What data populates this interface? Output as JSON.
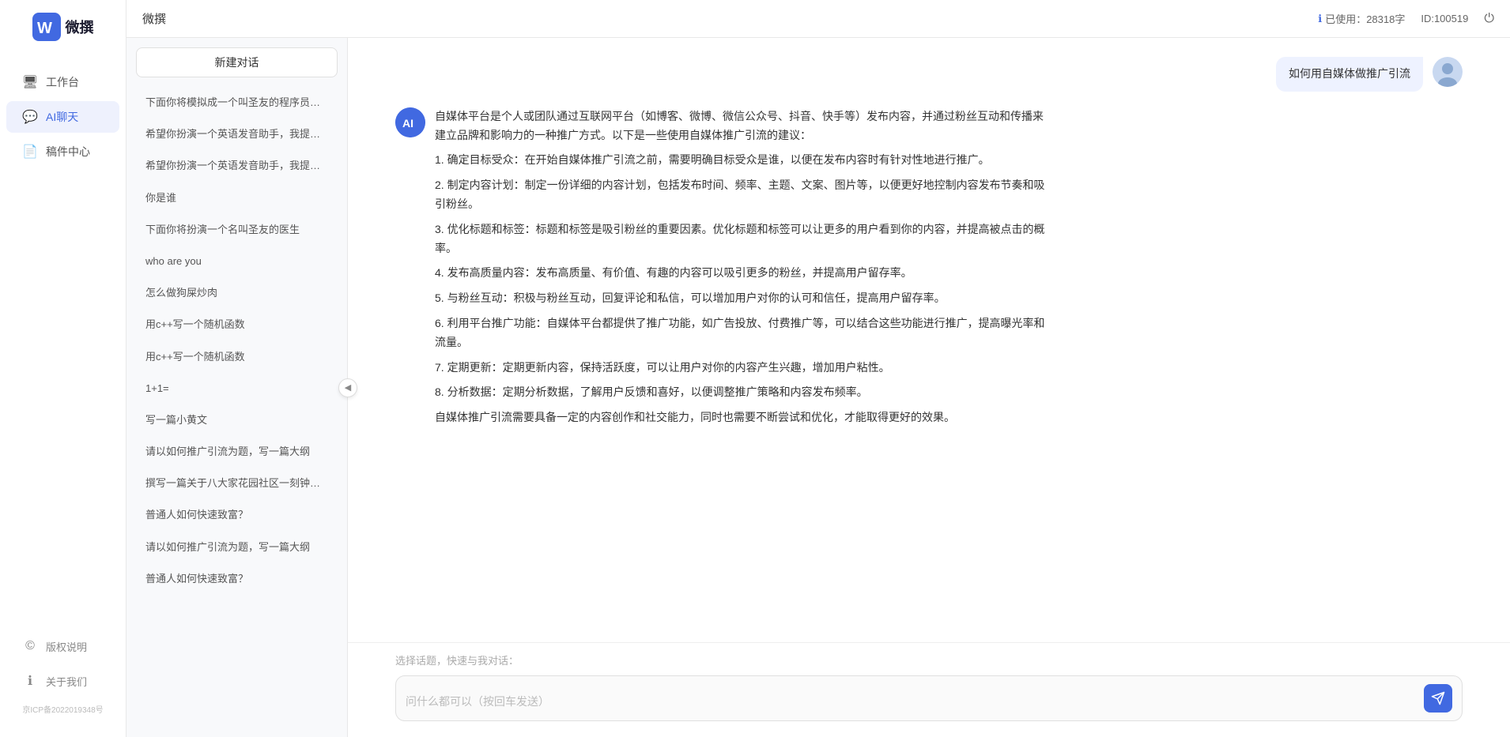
{
  "app": {
    "name": "微撰",
    "logo_letter": "W"
  },
  "topbar": {
    "title": "微撰",
    "usage_label": "已使用：28318字",
    "id_label": "ID:100519",
    "usage_icon": "ℹ"
  },
  "nav": {
    "items": [
      {
        "id": "workspace",
        "label": "工作台",
        "icon": "🖥"
      },
      {
        "id": "ai-chat",
        "label": "AI聊天",
        "icon": "💬",
        "active": true
      },
      {
        "id": "drafts",
        "label": "稿件中心",
        "icon": "📄"
      }
    ],
    "bottom_items": [
      {
        "id": "copyright",
        "label": "版权说明",
        "icon": "©"
      },
      {
        "id": "about",
        "label": "关于我们",
        "icon": "ℹ"
      }
    ],
    "icp": "京ICP备2022019348号"
  },
  "chat_list": {
    "new_chat_label": "新建对话",
    "items": [
      {
        "id": 1,
        "text": "下面你将模拟成一个叫圣友的程序员，我说..."
      },
      {
        "id": 2,
        "text": "希望你扮演一个英语发音助手，我提供给你..."
      },
      {
        "id": 3,
        "text": "希望你扮演一个英语发音助手，我提供给你..."
      },
      {
        "id": 4,
        "text": "你是谁",
        "active": true
      },
      {
        "id": 5,
        "text": "下面你将扮演一个名叫圣友的医生"
      },
      {
        "id": 6,
        "text": "who are you"
      },
      {
        "id": 7,
        "text": "怎么做狗屎炒肉"
      },
      {
        "id": 8,
        "text": "用c++写一个随机函数"
      },
      {
        "id": 9,
        "text": "用c++写一个随机函数"
      },
      {
        "id": 10,
        "text": "1+1="
      },
      {
        "id": 11,
        "text": "写一篇小黄文"
      },
      {
        "id": 12,
        "text": "请以如何推广引流为题，写一篇大纲"
      },
      {
        "id": 13,
        "text": "撰写一篇关于八大家花园社区一刻钟便民生..."
      },
      {
        "id": 14,
        "text": "普通人如何快速致富？"
      },
      {
        "id": 15,
        "text": "请以如何推广引流为题，写一篇大纲"
      },
      {
        "id": 16,
        "text": "普通人如何快速致富？"
      }
    ]
  },
  "chat": {
    "user_message": "如何用自媒体做推广引流",
    "ai_response": {
      "paragraphs": [
        "自媒体平台是个人或团队通过互联网平台（如博客、微博、微信公众号、抖音、快手等）发布内容，并通过粉丝互动和传播来建立品牌和影响力的一种推广方式。以下是一些使用自媒体推广引流的建议：",
        "1. 确定目标受众：在开始自媒体推广引流之前，需要明确目标受众是谁，以便在发布内容时有针对性地进行推广。",
        "2. 制定内容计划：制定一份详细的内容计划，包括发布时间、频率、主题、文案、图片等，以便更好地控制内容发布节奏和吸引粉丝。",
        "3. 优化标题和标签：标题和标签是吸引粉丝的重要因素。优化标题和标签可以让更多的用户看到你的内容，并提高被点击的概率。",
        "4. 发布高质量内容：发布高质量、有价值、有趣的内容可以吸引更多的粉丝，并提高用户留存率。",
        "5. 与粉丝互动：积极与粉丝互动，回复评论和私信，可以增加用户对你的认可和信任，提高用户留存率。",
        "6. 利用平台推广功能：自媒体平台都提供了推广功能，如广告投放、付费推广等，可以结合这些功能进行推广，提高曝光率和流量。",
        "7. 定期更新：定期更新内容，保持活跃度，可以让用户对你的内容产生兴趣，增加用户粘性。",
        "8. 分析数据：定期分析数据，了解用户反馈和喜好，以便调整推广策略和内容发布频率。",
        "自媒体推广引流需要具备一定的内容创作和社交能力，同时也需要不断尝试和优化，才能取得更好的效果。"
      ]
    }
  },
  "input": {
    "placeholder": "问什么都可以（按回车发送）",
    "quick_topic_label": "选择话题，快速与我对话："
  }
}
